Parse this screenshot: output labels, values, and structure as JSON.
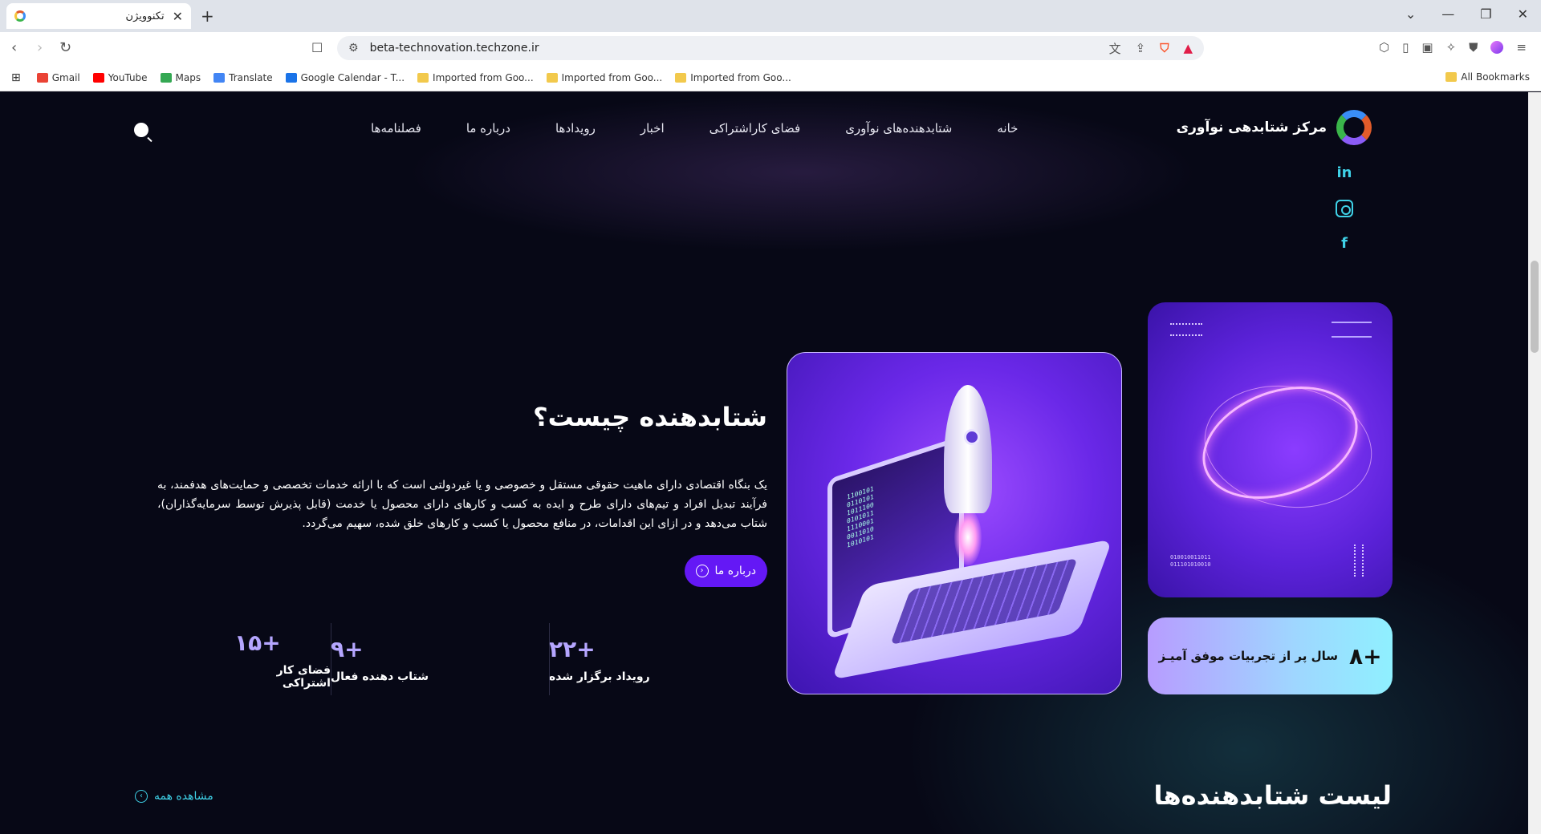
{
  "browser": {
    "tab_title": "تکنوویژن",
    "url": "beta-technovation.techzone.ir",
    "bookmarks": [
      "Gmail",
      "YouTube",
      "Maps",
      "Translate",
      "Google Calendar - T...",
      "Imported from Goo...",
      "Imported from Goo...",
      "Imported from Goo..."
    ],
    "all_bookmarks": "All Bookmarks"
  },
  "site": {
    "logo_text": "مرکز شتابدهی نوآوری",
    "nav": [
      "خانه",
      "شتابدهنده‌های نوآوری",
      "فضای کاراشتراکی",
      "اخبار",
      "رویدادها",
      "درباره ما",
      "فصلنامه‌ها"
    ]
  },
  "hero": {
    "title": "شتابدهنده چیست؟",
    "description": "یک بنگاه اقتصادی دارای ماهیت حقوقی مستقل و خصوصی و یا غیردولتی است که با ارائه خدمات تخصصی و حمایت‌های هدفمند، به فرآیند تبدیل افراد و تیم‌های دارای طرح و ایده به کسب و کارهای دارای محصول یا خدمت (قابل پذیرش توسط سرمایه‌گذاران)، شتاب می‌دهد و در ازای این اقدامات، در منافع محصول یا کسب و کارهای خلق شده، سهیم می‌گردد.",
    "about_button": "درباره ما"
  },
  "experience": {
    "number": "+۸",
    "text": "سال پر از تجربیات موفق آمیـز"
  },
  "stats": [
    {
      "number": "+۲۲",
      "label": "رویداد برگزار شده"
    },
    {
      "number": "+۹",
      "label": "شتاب دهنده فعال"
    },
    {
      "number": "+۱۵",
      "label": "فضای کار اشتراکی"
    }
  ],
  "accelerators": {
    "title": "لیست شتابدهنده‌ها",
    "view_all": "مشاهده همه"
  },
  "illustration": {
    "code": "1100101\n0110101\n1011100\n0101011\n1110001\n0011010\n1010101",
    "binary_a": "010010011011",
    "binary_b": "011101010010"
  },
  "colors": {
    "accent": "#6418f5",
    "cyan": "#3fd2e8",
    "stat": "#b5a6ff",
    "bg": "#070816"
  }
}
